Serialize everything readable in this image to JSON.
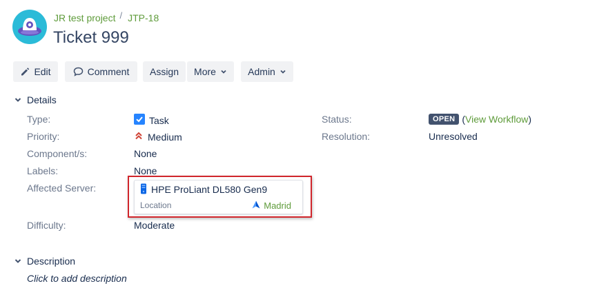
{
  "header": {
    "project": "JR test project",
    "issue_key": "JTP-18",
    "title": "Ticket 999",
    "avatar_icon": "project-avatar-icon"
  },
  "toolbar": {
    "edit": "Edit",
    "comment": "Comment",
    "assign": "Assign",
    "more": "More",
    "admin": "Admin"
  },
  "details": {
    "heading": "Details",
    "type": {
      "label": "Type:",
      "value": "Task"
    },
    "priority": {
      "label": "Priority:",
      "value": "Medium"
    },
    "components": {
      "label": "Component/s:",
      "value": "None"
    },
    "labels": {
      "label": "Labels:",
      "value": "None"
    },
    "affected_server": {
      "label": "Affected Server:",
      "name": "HPE ProLiant DL580 Gen9",
      "location_label": "Location",
      "location_value": "Madrid"
    },
    "difficulty": {
      "label": "Difficulty:",
      "value": "Moderate"
    },
    "status": {
      "label": "Status:",
      "value": "OPEN",
      "workflow_link": "View Workflow",
      "open_paren": "(",
      "close_paren": ")"
    },
    "resolution": {
      "label": "Resolution:",
      "value": "Unresolved"
    }
  },
  "description": {
    "heading": "Description",
    "placeholder": "Click to add description"
  },
  "colors": {
    "link": "#5e9b3a",
    "status_lozenge": "#42526e",
    "highlight_border": "#d0252b",
    "task_icon": "#2684ff",
    "priority_icon": "#d04437"
  }
}
